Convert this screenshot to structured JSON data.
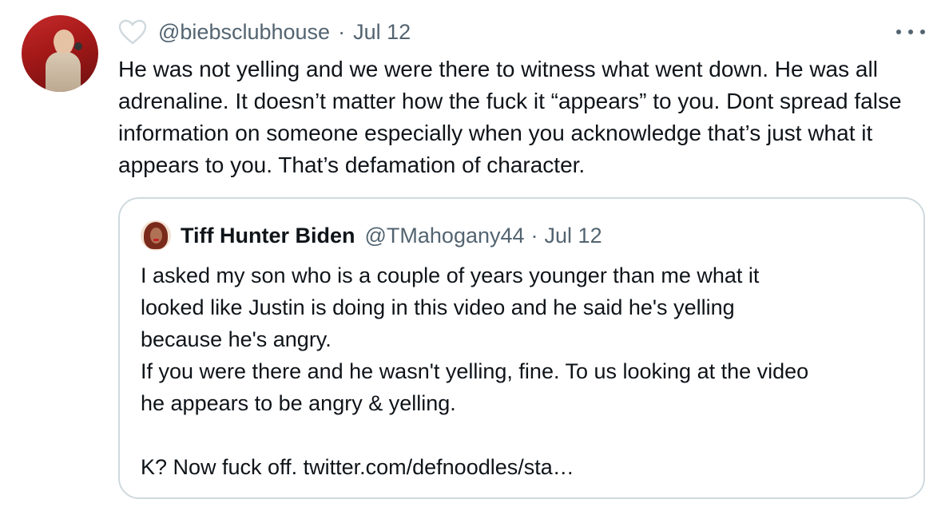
{
  "tweet": {
    "handle": "@biebsclubhouse",
    "separator": "·",
    "date": "Jul 12",
    "text": "He was not yelling and we were there to witness what went down. He was all adrenaline. It doesn’t matter how the fuck it “appears” to you. Dont spread false information on someone especially when you acknowledge that’s just what it appears to you. That’s defamation of character.",
    "like_icon": "heart-outline-icon",
    "more_icon": "more-dots-icon"
  },
  "quote": {
    "display_name": "Tiff Hunter Biden",
    "handle": "@TMahogany44",
    "separator": "·",
    "date": "Jul 12",
    "lines": [
      "I asked my son who is a couple of years younger than me what it",
      "looked like Justin is doing in this video and he said he's yelling",
      "because he's angry.",
      "If you were there and he wasn't yelling, fine. To us looking at the video",
      "he appears to be angry & yelling.",
      "",
      "K? Now fuck off. twitter.com/defnoodles/sta…"
    ]
  },
  "colors": {
    "text_primary": "#0f1419",
    "text_secondary": "#536471",
    "border": "#cfd9de",
    "heart": "#cfd9de"
  }
}
